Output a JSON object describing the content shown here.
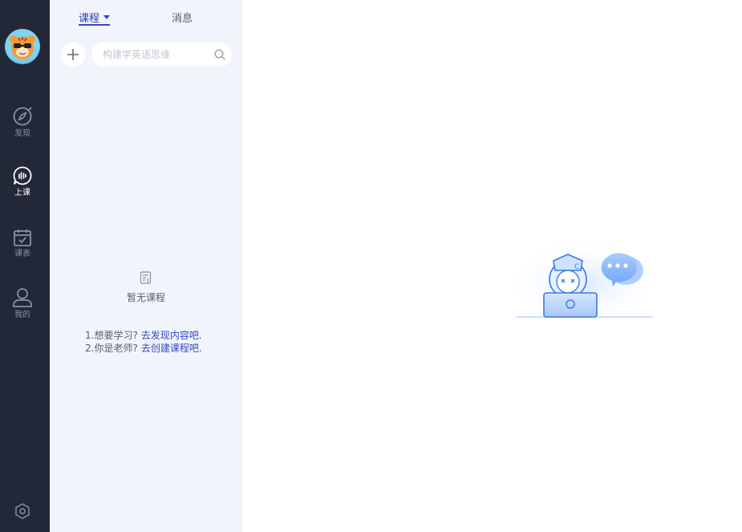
{
  "rail": {
    "items": [
      {
        "key": "discover",
        "label": "发现",
        "icon": "compass-icon",
        "active": false
      },
      {
        "key": "class",
        "label": "上课",
        "icon": "chat-wave-icon",
        "active": true
      },
      {
        "key": "schedule",
        "label": "课表",
        "icon": "calendar-check-icon",
        "active": false
      },
      {
        "key": "mine",
        "label": "我的",
        "icon": "user-icon",
        "active": false
      }
    ],
    "settings_icon": "hexagon-settings-icon"
  },
  "panel": {
    "tabs": [
      {
        "label": "课程",
        "active": true
      },
      {
        "label": "消息",
        "active": false
      }
    ],
    "search": {
      "placeholder": "构建学英语思维"
    },
    "empty": {
      "title": "暂无课程",
      "hints": [
        {
          "prefix": "1.想要学习?",
          "link": "去发现内容吧."
        },
        {
          "prefix": "2.你是老师?",
          "link": "去创建课程吧."
        }
      ]
    }
  },
  "colors": {
    "rail_bg": "#232838",
    "panel_bg": "#f1f4fa",
    "accent": "#3347c4"
  }
}
